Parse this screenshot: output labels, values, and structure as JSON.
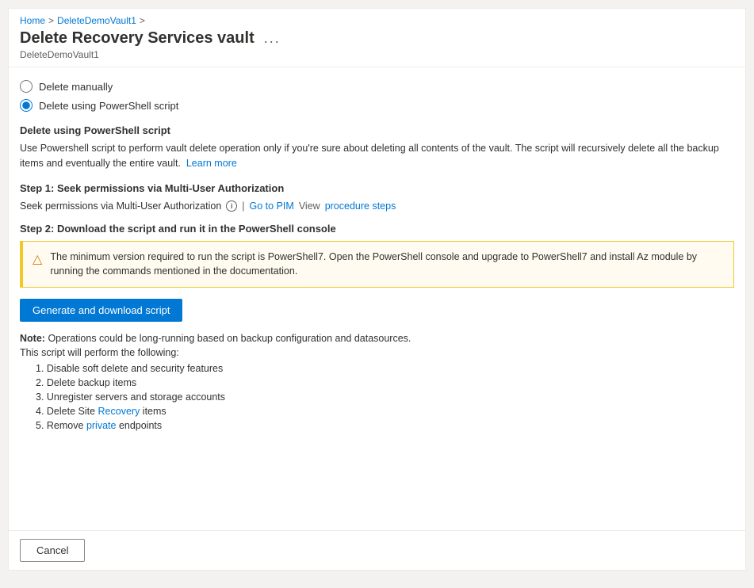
{
  "breadcrumb": {
    "home": "Home",
    "vault": "DeleteDemoVault1",
    "sep1": ">",
    "sep2": ">"
  },
  "page": {
    "title": "Delete Recovery Services vault",
    "subtitle": "DeleteDemoVault1",
    "ellipsis": "..."
  },
  "radio_options": [
    {
      "id": "manual",
      "label": "Delete manually",
      "checked": false
    },
    {
      "id": "powershell",
      "label": "Delete using PowerShell script",
      "checked": true
    }
  ],
  "section": {
    "title": "Delete using PowerShell script",
    "desc_prefix": "Use Powershell script to perform vault delete operation only if you're sure about deleting all contents of the vault. The script will recursively delete all the backup items and eventually the entire vault.",
    "learn_more_text": "Learn more",
    "learn_more_url": "#"
  },
  "step1": {
    "title": "Step 1: Seek permissions via Multi-User Authorization",
    "seek_label": "Seek permissions via Multi-User Authorization",
    "go_to_pim": "Go to PIM",
    "pipe": "|",
    "view_label": "View",
    "procedure_steps": "procedure steps"
  },
  "step2": {
    "title": "Step 2: Download the script and run it in the PowerShell console",
    "warning": "The minimum version required to run the script is PowerShell7. Open the PowerShell console and upgrade to PowerShell7 and install Az module by running the commands mentioned in the documentation.",
    "btn_label": "Generate and download script",
    "note_label": "Note:",
    "note_text": "Operations could be long-running based on backup configuration and datasources.",
    "note_sub": "This script will perform the following:",
    "list": [
      {
        "num": "1",
        "text": "Disable soft delete and security features"
      },
      {
        "num": "2",
        "text": "Delete backup items"
      },
      {
        "num": "3",
        "text": "Unregister servers and storage accounts"
      },
      {
        "num": "4",
        "text": "Delete Site Recovery items",
        "link": true,
        "link_text": "Recovery"
      },
      {
        "num": "5",
        "text": "Remove private endpoints",
        "link": true,
        "link_text": "private"
      }
    ]
  },
  "footer": {
    "cancel_label": "Cancel"
  }
}
